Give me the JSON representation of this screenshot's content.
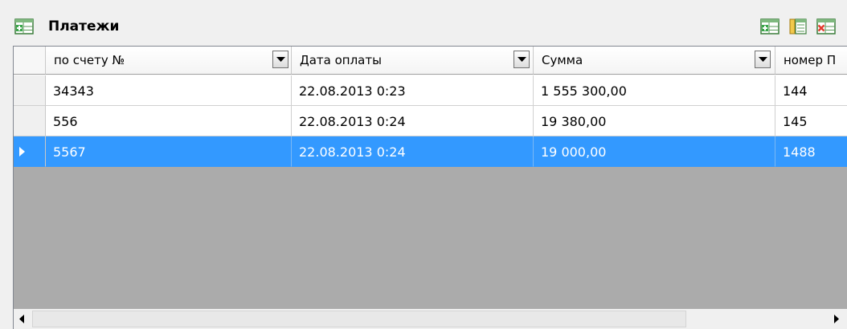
{
  "panel": {
    "title": "Платежи",
    "icon": "add-record-icon",
    "toolbar": [
      {
        "name": "add-record-icon"
      },
      {
        "name": "columns-icon"
      },
      {
        "name": "delete-record-icon"
      }
    ]
  },
  "grid": {
    "columns": [
      {
        "label": "по счету №",
        "has_dropdown": true
      },
      {
        "label": "Дата оплаты",
        "has_dropdown": true
      },
      {
        "label": "Сумма",
        "has_dropdown": true
      },
      {
        "label": "номер П",
        "has_dropdown": false
      }
    ],
    "rows": [
      {
        "invoice": "34343",
        "date": "22.08.2013 0:23",
        "amount": "1 555 300,00",
        "number": "144",
        "selected": false
      },
      {
        "invoice": "556",
        "date": "22.08.2013 0:24",
        "amount": "19 380,00",
        "number": "145",
        "selected": false
      },
      {
        "invoice": "5567",
        "date": "22.08.2013 0:24",
        "amount": "19 000,00",
        "number": "1488",
        "selected": true
      }
    ],
    "selected_row_marker": "row-pointer-icon"
  },
  "scrollbar": {
    "left_icon": "scroll-left-icon",
    "right_icon": "scroll-right-icon"
  },
  "colors": {
    "selection": "#3399ff",
    "empty_area": "#ababab",
    "icon_green": "#3aa64a",
    "icon_red": "#e23b2e"
  }
}
